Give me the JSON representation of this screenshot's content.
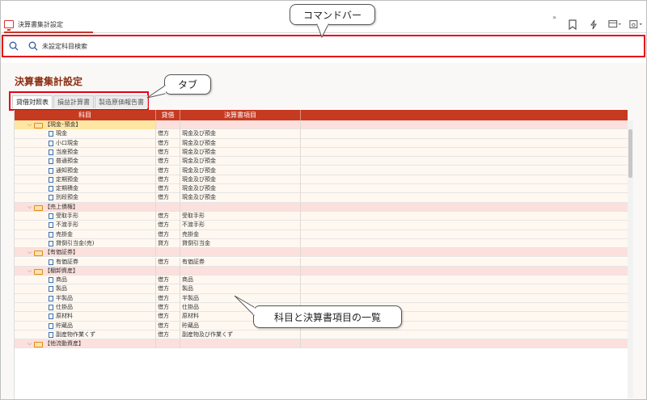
{
  "window": {
    "title": "決算書集計設定"
  },
  "command_bar": {
    "search_label": "未設定科目検索"
  },
  "page": {
    "title": "決算書集計設定"
  },
  "tabs": [
    {
      "label": "貸借対照表",
      "active": true
    },
    {
      "label": "損益計算書",
      "active": false
    },
    {
      "label": "製造原価報告書",
      "active": false
    }
  ],
  "table": {
    "headers": [
      "科目",
      "貸借",
      "決算書項目"
    ],
    "rows": [
      {
        "type": "group",
        "label": "【現金･預金】",
        "selected": true
      },
      {
        "type": "item",
        "label": "現金",
        "side": "借方",
        "item": "現金及び預金"
      },
      {
        "type": "item",
        "label": "小口現金",
        "side": "借方",
        "item": "現金及び預金"
      },
      {
        "type": "item",
        "label": "当座預金",
        "side": "借方",
        "item": "現金及び預金"
      },
      {
        "type": "item",
        "label": "普通預金",
        "side": "借方",
        "item": "現金及び預金"
      },
      {
        "type": "item",
        "label": "通知預金",
        "side": "借方",
        "item": "現金及び預金"
      },
      {
        "type": "item",
        "label": "定期預金",
        "side": "借方",
        "item": "現金及び預金"
      },
      {
        "type": "item",
        "label": "定期積金",
        "side": "借方",
        "item": "現金及び預金"
      },
      {
        "type": "item",
        "label": "別段預金",
        "side": "借方",
        "item": "現金及び預金"
      },
      {
        "type": "group",
        "label": "【売上債権】"
      },
      {
        "type": "item",
        "label": "受取手形",
        "side": "借方",
        "item": "受取手形"
      },
      {
        "type": "item",
        "label": "不渡手形",
        "side": "借方",
        "item": "不渡手形"
      },
      {
        "type": "item",
        "label": "売掛金",
        "side": "借方",
        "item": "売掛金"
      },
      {
        "type": "item",
        "label": "貸倒引当金(売)",
        "side": "貸方",
        "item": "貸倒引当金"
      },
      {
        "type": "group",
        "label": "【有価証券】"
      },
      {
        "type": "item",
        "label": "有価証券",
        "side": "借方",
        "item": "有価証券"
      },
      {
        "type": "group",
        "label": "【棚卸資産】"
      },
      {
        "type": "item",
        "label": "商品",
        "side": "借方",
        "item": "商品"
      },
      {
        "type": "item",
        "label": "製品",
        "side": "借方",
        "item": "製品"
      },
      {
        "type": "item",
        "label": "半製品",
        "side": "借方",
        "item": "半製品"
      },
      {
        "type": "item",
        "label": "仕掛品",
        "side": "借方",
        "item": "仕掛品"
      },
      {
        "type": "item",
        "label": "原材料",
        "side": "借方",
        "item": "原材料"
      },
      {
        "type": "item",
        "label": "貯蔵品",
        "side": "借方",
        "item": "貯蔵品"
      },
      {
        "type": "item",
        "label": "副産物作業くず",
        "side": "借方",
        "item": "副産物及び作業くず"
      },
      {
        "type": "group",
        "label": "【他流動資産】"
      }
    ]
  },
  "callouts": {
    "command_bar": "コマンドバー",
    "tabs": "タブ",
    "list": "科目と決算書項目の一覧"
  },
  "colors": {
    "accent": "#c63a22",
    "highlight_border": "#e60012",
    "title": "#8b2f12"
  }
}
